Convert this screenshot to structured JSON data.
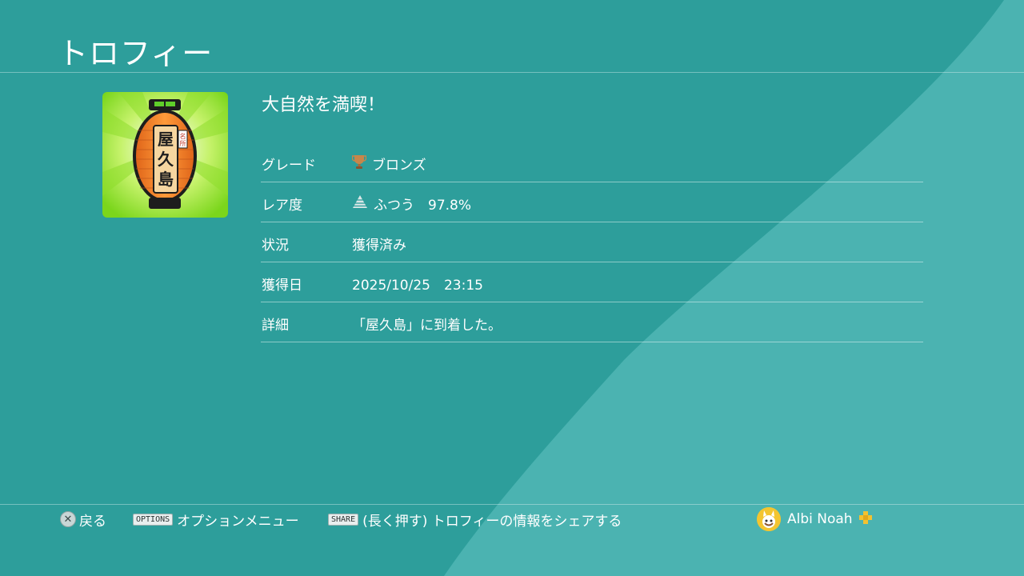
{
  "header": {
    "title": "トロフィー"
  },
  "trophy": {
    "name": "大自然を満喫！",
    "icon": {
      "name": "lantern-icon",
      "text": "屋久島",
      "small_text": "名所"
    }
  },
  "details": [
    {
      "key": "grade",
      "label": "グレード",
      "value": "ブロンズ",
      "icon": "bronze-trophy-icon"
    },
    {
      "key": "rarity",
      "label": "レア度",
      "value": "ふつう　97.8%",
      "icon": "rarity-pyramid-icon"
    },
    {
      "key": "status",
      "label": "状況",
      "value": "獲得済み"
    },
    {
      "key": "earned-date",
      "label": "獲得日",
      "value": "2025/10/25　23:15"
    },
    {
      "key": "description",
      "label": "詳細",
      "value": "「屋久島」に到着した。"
    }
  ],
  "footer": {
    "back_label": "戻る",
    "options_key": "OPTIONS",
    "options_label": "オプションメニュー",
    "share_key": "SHARE",
    "share_label": "(長く押す) トロフィーの情報をシェアする",
    "user_name": "Albi Noah",
    "plus_icon": "ps-plus-icon"
  },
  "colors": {
    "background": "#2d9e9b",
    "wave": "#4bb3b1",
    "bronze": "#c8864a",
    "lantern": "#f28a2e"
  }
}
